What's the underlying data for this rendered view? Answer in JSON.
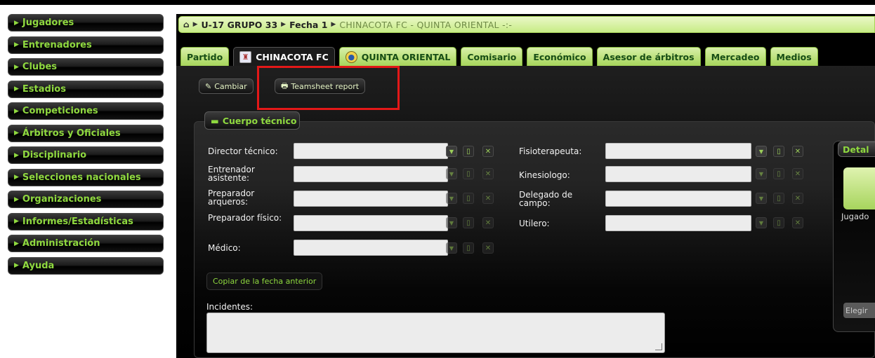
{
  "sidebar": {
    "items": [
      {
        "label": "Jugadores"
      },
      {
        "label": "Entrenadores"
      },
      {
        "label": "Clubes"
      },
      {
        "label": "Estadios"
      },
      {
        "label": "Competiciones"
      },
      {
        "label": "Árbitros y Oficiales"
      },
      {
        "label": "Disciplinario"
      },
      {
        "label": "Selecciones nacionales"
      },
      {
        "label": "Organizaciones"
      },
      {
        "label": "Informes/Estadísticas"
      },
      {
        "label": "Administración"
      },
      {
        "label": "Ayuda"
      }
    ]
  },
  "breadcrumb": {
    "group": "U-17 GRUPO 33",
    "fecha": "Fecha 1",
    "match": "CHINACOTA FC - QUINTA ORIENTAL -:-"
  },
  "tabs": [
    {
      "label": "Partido"
    },
    {
      "label": "CHINACOTA FC"
    },
    {
      "label": "QUINTA ORIENTAL"
    },
    {
      "label": "Comisario"
    },
    {
      "label": "Económico"
    },
    {
      "label": "Asesor de árbitros"
    },
    {
      "label": "Mercadeo"
    },
    {
      "label": "Medios"
    }
  ],
  "toolbar": {
    "cambiar": "Cambiar",
    "teamsheet": "Teamsheet report"
  },
  "staff": {
    "legend": "Cuerpo técnico",
    "director": "Director técnico:",
    "entrenador": "Entrenador asistente:",
    "preparador_arq": "Preparador arqueros:",
    "preparador_fis": "Preparador físico:",
    "medico": "Médico:",
    "fisio": "Fisioterapeuta:",
    "kinesio": "Kinesiologo:",
    "delegado": "Delegado de campo:",
    "utilero": "Utilero:"
  },
  "copy_label": "Copiar de la fecha anterior",
  "incidents_label": "Incidentes:",
  "details": {
    "title": "Detal",
    "jugador": "Jugado",
    "elegir": "Elegir"
  },
  "colors": {
    "accent_green": "#8fd93f",
    "highlight_red": "#e31818"
  }
}
